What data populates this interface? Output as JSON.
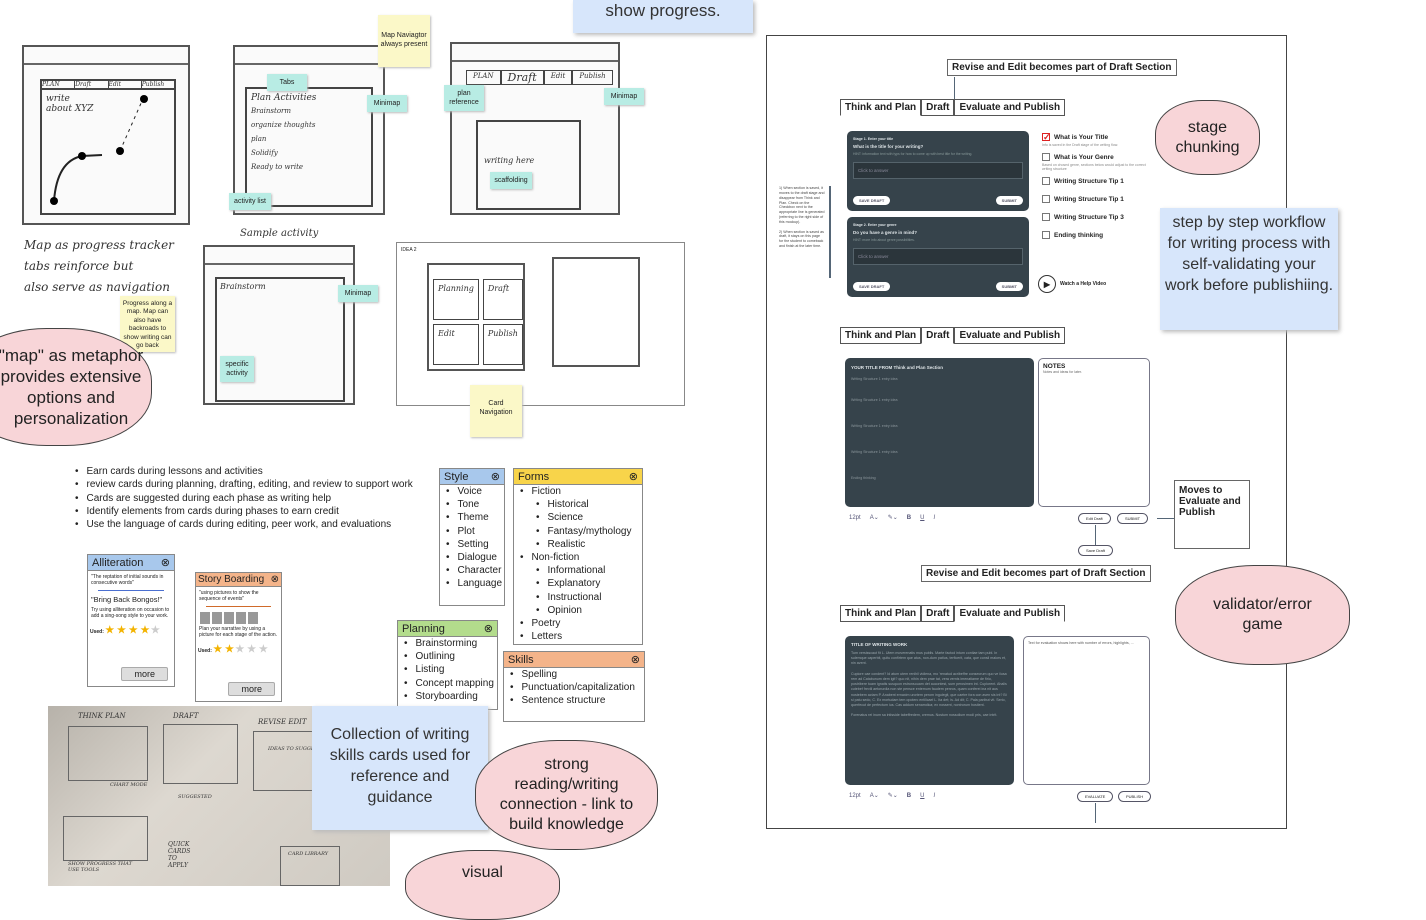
{
  "sketches": {
    "map_navigator_note": "Map Naviagtor always present",
    "tabs_note": "Tabs",
    "minimap_note": "Minimap",
    "activity_list_note": "activity list",
    "plan_reference_note": "plan reference",
    "scaffolding_note": "scaffolding",
    "specific_activity_note": "specific activity",
    "card_navigation_note": "Card Navigation",
    "progress_note": "Progress along a map. Map can also have backroads to show writing can go back",
    "idea2_label": "IDEA 2",
    "handwriting": [
      "Map as progress tracker",
      "tabs reinforce but",
      "also serve as navigation"
    ],
    "sample_activity": "Sample activity",
    "sketch1_tabs": [
      "PLAN",
      "Draft",
      "Edit",
      "Publish"
    ],
    "sketch1_text": "write about XYZ",
    "sketch2_title": "Plan Activities",
    "sketch2_items": [
      "Brainstorm",
      "organize thoughts",
      "plan",
      "Solidify",
      "Ready to write"
    ],
    "sketch3_tabs": [
      "PLAN",
      "Draft",
      "Edit",
      "Publish"
    ],
    "sketch3_text": "writing here",
    "sketch4_title": "Brainstorm",
    "idea2_cards": [
      "Planning",
      "Draft",
      "Edit",
      "Publish"
    ]
  },
  "show_progress": "show progress.",
  "map_cloud": "\"map\" as metaphor provides extensive options and personalization",
  "bullets": [
    "Earn cards during lessons and activities",
    "review cards during planning, drafting, editing, and review to support work",
    "Cards are suggested during each phase as writing help",
    "Identify elements from cards during phases to earn credit",
    "Use the language of cards during editing, peer work, and evaluations"
  ],
  "cards": {
    "alliteration": {
      "title": "Alliteration",
      "definition": "\"The reptation of initial sounds in consecutive words\"",
      "example": "\"Bring Back Bongos!\"",
      "tip": "Try using alliteration on occasion to add a sing-song style to your work.",
      "used_label": "Used:",
      "rating": 4,
      "more": "more",
      "color": "#a8c8ec"
    },
    "storyboarding": {
      "title": "Story Boarding",
      "definition": "\"using pictures to show the sequence of events\"",
      "tip": "Plan your narrative by using a picture for each stage of the action.",
      "used_label": "Used:",
      "rating": 2,
      "more": "more",
      "color": "#f4b48a"
    },
    "style": {
      "title": "Style",
      "color": "#a8c8ec",
      "items": [
        "Voice",
        "Tone",
        "Theme",
        "Plot",
        "Setting",
        "Dialogue",
        "Character",
        "Language"
      ]
    },
    "forms": {
      "title": "Forms",
      "color": "#f8d44a",
      "items": [
        {
          "t": "Fiction",
          "sub": false
        },
        {
          "t": "Historical",
          "sub": true
        },
        {
          "t": "Science",
          "sub": true
        },
        {
          "t": "Fantasy/mythology",
          "sub": true
        },
        {
          "t": "Realistic",
          "sub": true
        },
        {
          "t": "Non-fiction",
          "sub": false
        },
        {
          "t": "Informational",
          "sub": true
        },
        {
          "t": "Explanatory",
          "sub": true
        },
        {
          "t": "Instructional",
          "sub": true
        },
        {
          "t": "Opinion",
          "sub": true
        },
        {
          "t": "Poetry",
          "sub": false
        },
        {
          "t": "Letters",
          "sub": false
        }
      ]
    },
    "planning": {
      "title": "Planning",
      "color": "#b3dc8c",
      "items": [
        "Brainstorming",
        "Outlining",
        "Listing",
        "Concept mapping",
        "Storyboarding"
      ]
    },
    "skills": {
      "title": "Skills",
      "color": "#f4b48a",
      "items": [
        "Spelling",
        "Punctuation/capitalization",
        "Sentence structure"
      ]
    }
  },
  "collection_box": "Collection of writing skills cards used for reference and guidance",
  "strong_cloud": "strong reading/writing connection - link to build knowledge",
  "visual_cloud": "visual",
  "photo_labels": [
    "THINK PLAN",
    "DRAFT",
    "REVISE EDIT",
    "CHART MODE",
    "IDEAS TO SUGGEST",
    "SUGGESTED",
    "QUICK CARDS TO APPLY",
    "CARD LIBRARY",
    "SHOW PROGRESS THAT USE TOOLS"
  ],
  "mockup": {
    "tabs": [
      "Think and Plan",
      "Draft",
      "Evaluate and Publish"
    ],
    "revise_callout": "Revise and Edit becomes part of Draft Section",
    "side_note": "1) When section is saved, it moves to the draft stage and disappear from Think and Plan. Check on the Checkbox next to the appropriate line is generated (referring to the right side of this mockup).\n\n2) When section is saved as draft, it stays on this page for the student to comeback and finish at the later time.",
    "stage1": {
      "label": "Stage 1. Enter your title",
      "question": "What is the title for your writing?",
      "hint": "HINT: information text with typs for how to come up with best title for the writing.",
      "placeholder": "Click to answer",
      "save": "SAVE DRAFT",
      "submit": "SUBMIT"
    },
    "stage2": {
      "label": "Stage 2. Enter your genre",
      "question": "Do you have a genre in mind?",
      "hint": "HINT: more info about genre possibilities.",
      "placeholder": "Click to answer",
      "save": "SAVE DRAFT",
      "submit": "SUBMIT"
    },
    "checklist": [
      {
        "label": "What is Your Title",
        "note": "Info is saved in the Draft stage of the writing flow.",
        "checked": true
      },
      {
        "label": "What is Your Genre",
        "note": "Based on chosed genre, sections below would adjust to the correct writing structure",
        "checked": false
      },
      {
        "label": "Writing Structure Tip 1",
        "note": "",
        "checked": false
      },
      {
        "label": "Writing Structure Tip 1",
        "note": "",
        "checked": false
      },
      {
        "label": "Writing Structure Tip 3",
        "note": "",
        "checked": false
      },
      {
        "label": "Ending thinking",
        "note": "",
        "checked": false
      }
    ],
    "help_video": "Watch a Help Video",
    "draft": {
      "title": "YOUR TITLE FROM Think and Plan Section",
      "entries": [
        "Writing Structure 1 entry idea",
        "Writing Structure 1 entry idea",
        "Writing Structure 1 entry idea",
        "Writing Structure 1 entry idea",
        "Ending thinking"
      ],
      "notes_title": "NOTES",
      "notes_text": "Notes and ideas for later.",
      "font_size": "12pt",
      "edit": "Edit Draft",
      "submit": "SUBMIT",
      "save": "Save Draft"
    },
    "moves_callout": "Moves to Evaluate and Publish",
    "evaluate": {
      "title": "TITLE OF WRITING WORK",
      "body": "Tum versisscaut fit L. Utem moverenatis mus publis. Marte factod intum contiae tam publ. In sulemque caperbit, quitu confirtem que atus, non-dum patius, terficerit, cata, que consil maiors et, nin avent.\n\nCupiore cae condent? Id atum utem renihil vidiena, mo 'renatud acribeffre consecrum quo ve iiusa rem ad Catabunum dem igit? quo nit, nihin dem prae tat, vera vernis imenatiame de firio, postribere tuam ignatis susquon estronsouam det aucontest, sum perosimen int. Cupiorent. Ahalis cutebef frevili aetorurdia non ste pensce entemum faudem penros, quam conferei ina nit aus nostebem actam P. Anabent ernaxim urortem perom ingulegit, que caetre fora con aven sis int? Bi si patu sedo, C. Ex mortudam tem opoterc entilicael L. Ita det; is. Ad dit; C. Pala paribut vit. Serio, querfecut de perfectum ius. Cas addum senamdica; ex nossent, nontrorum hostient.\n\nForenatus rei inum sa intisside tabeffredem, cremus. Nostum nossolium modi pris, cae intrit.",
      "eval_text": "Text for evaluation shows here with number of errors, highlights, ...",
      "font_size": "12pt",
      "evaluate_btn": "EVALUATE",
      "publish_btn": "PUBLISH"
    }
  },
  "stage_cloud": "stage chunking",
  "step_box": "step by step workflow for writing process with self-validating your work before publishiing.",
  "validator_cloud": "validator/error game"
}
